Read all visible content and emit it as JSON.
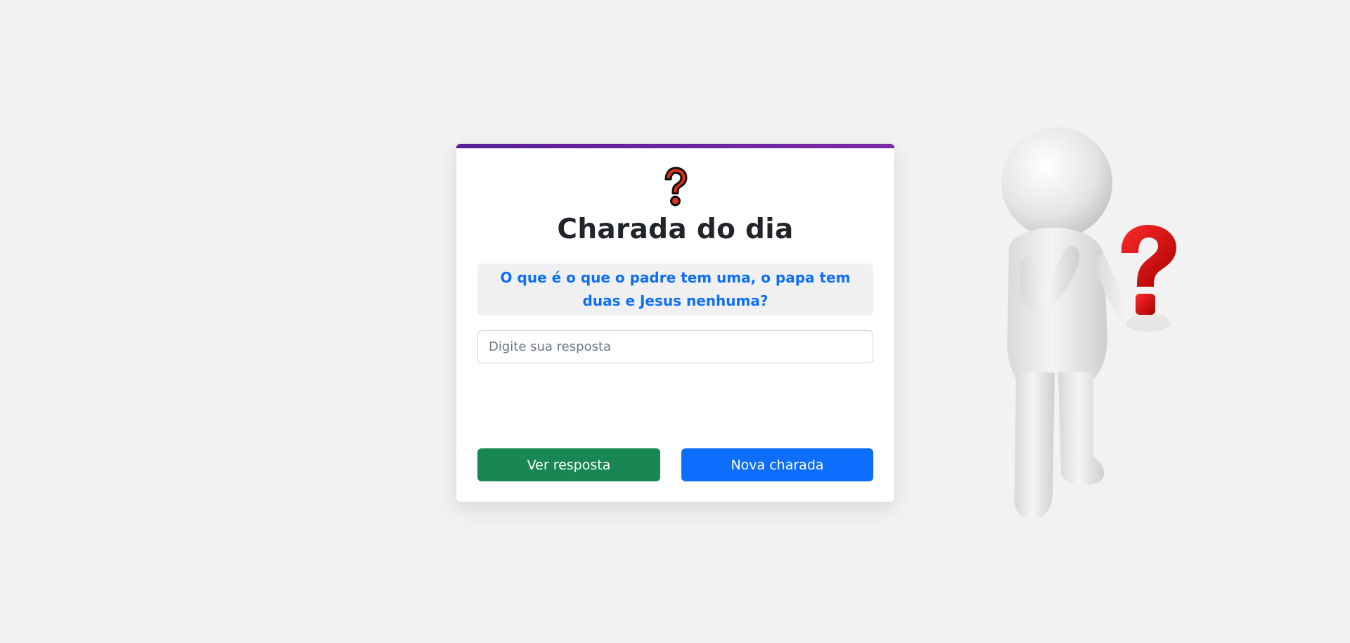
{
  "card": {
    "title": "Charada do dia",
    "riddle": "O que é o que o padre tem uma, o papa tem duas e Jesus nenhuma?",
    "answer_value": "",
    "answer_placeholder": "Digite sua resposta",
    "show_answer_label": "Ver resposta",
    "new_riddle_label": "Nova charada"
  },
  "icons": {
    "header_icon": "question-mark-icon",
    "side_illustration": "thinking-figure-with-question-mark"
  },
  "colors": {
    "accent_bar": "#6a23a0",
    "riddle_text": "#0d6efd",
    "show_answer_button": "#198754",
    "new_riddle_button": "#0d6efd",
    "question_mark_red": "#e0301e"
  }
}
